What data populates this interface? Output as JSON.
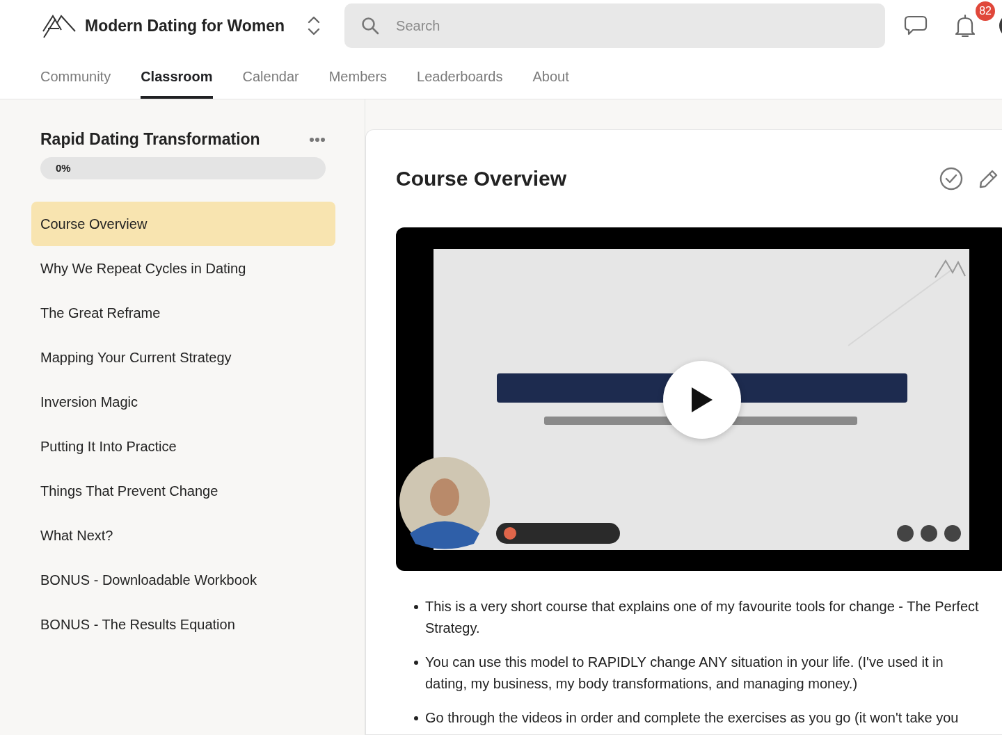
{
  "community": {
    "name": "Modern Dating for Women"
  },
  "search": {
    "placeholder": "Search"
  },
  "notifications": {
    "count": "82"
  },
  "tabs": [
    {
      "label": "Community",
      "selected": false
    },
    {
      "label": "Classroom",
      "selected": true
    },
    {
      "label": "Calendar",
      "selected": false
    },
    {
      "label": "Members",
      "selected": false
    },
    {
      "label": "Leaderboards",
      "selected": false
    },
    {
      "label": "About",
      "selected": false
    }
  ],
  "course": {
    "title": "Rapid Dating Transformation",
    "progress": {
      "label": "0%",
      "level": 0
    },
    "lessons": [
      {
        "title": "Course Overview",
        "selected": true
      },
      {
        "title": "Why We Repeat Cycles in Dating",
        "selected": false
      },
      {
        "title": "The Great Reframe",
        "selected": false
      },
      {
        "title": "Mapping Your Current Strategy",
        "selected": false
      },
      {
        "title": "Inversion Magic",
        "selected": false
      },
      {
        "title": "Putting It Into Practice",
        "selected": false
      },
      {
        "title": "Things That Prevent Change",
        "selected": false
      },
      {
        "title": "What Next?",
        "selected": false
      },
      {
        "title": "BONUS - Downloadable Workbook",
        "selected": false
      },
      {
        "title": "BONUS - The Results Equation",
        "selected": false
      }
    ]
  },
  "lesson": {
    "title": "Course Overview",
    "bullets": [
      "This is a very short course that explains one of my favourite tools for change - The Perfect Strategy.",
      "You can use this model to RAPIDLY change ANY situation in your life. (I've used it in dating, my business, my body transformations, and managing money.)",
      "Go through the videos in order and complete the exercises as you go (it won't take you"
    ]
  }
}
